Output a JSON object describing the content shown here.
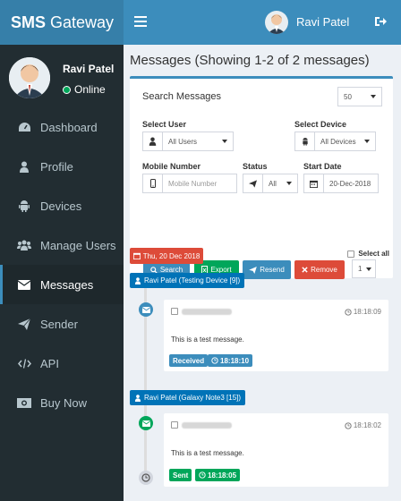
{
  "app": {
    "logo_bold": "SMS",
    "logo_rest": " Gateway"
  },
  "header": {
    "user_name": "Ravi Patel"
  },
  "sidebar": {
    "user_name": "Ravi Patel",
    "status": "Online",
    "items": [
      {
        "label": "Dashboard",
        "icon": "dashboard-icon"
      },
      {
        "label": "Profile",
        "icon": "user-icon"
      },
      {
        "label": "Devices",
        "icon": "android-icon"
      },
      {
        "label": "Manage Users",
        "icon": "users-icon"
      },
      {
        "label": "Messages",
        "icon": "envelope-icon",
        "active": true
      },
      {
        "label": "Sender",
        "icon": "paper-plane-icon"
      },
      {
        "label": "API",
        "icon": "code-icon"
      },
      {
        "label": "Buy Now",
        "icon": "money-icon"
      }
    ]
  },
  "main": {
    "title": "Messages (Showing 1-2 of 2 messages)",
    "search": {
      "heading": "Search Messages",
      "page_size": "50",
      "select_user_label": "Select User",
      "select_user_value": "All Users",
      "select_device_label": "Select Device",
      "select_device_value": "All Devices",
      "mobile_label": "Mobile Number",
      "mobile_placeholder": "Mobile Number",
      "status_label": "Status",
      "status_value": "All",
      "start_date_label": "Start Date",
      "start_date_value": "20-Dec-2018"
    },
    "buttons": {
      "search": "Search",
      "export": "Export",
      "resend": "Resend",
      "remove": "Remove",
      "bulk_count": "1"
    },
    "date_badge": "Thu, 20 Dec 2018",
    "select_all": "Select all",
    "messages": [
      {
        "device": "Ravi Patel (Testing Device [9])",
        "time": "18:18:09",
        "text": "This is a test message.",
        "status": "Received",
        "status_time": "18:18:10"
      },
      {
        "device": "Ravi Patel (Galaxy Note3 [15])",
        "time": "18:18:02",
        "text": "This is a test message.",
        "status": "Sent",
        "status_time": "18:18:05"
      }
    ]
  },
  "colors": {
    "primary": "#3c8dbc",
    "sidebar": "#222d32",
    "success": "#00a65a",
    "danger": "#dd4b39",
    "badge_blue": "#0073b7"
  }
}
